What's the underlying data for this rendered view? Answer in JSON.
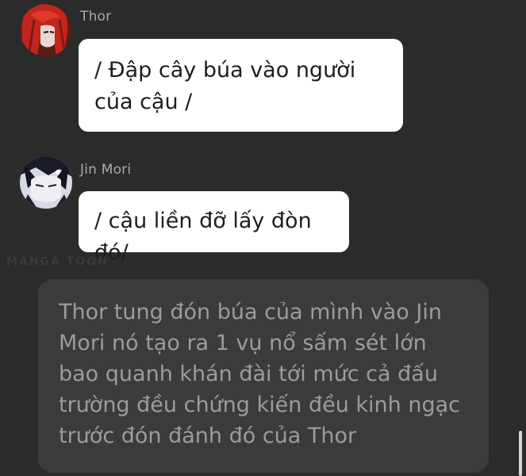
{
  "messages": [
    {
      "sender": "Thor",
      "avatar_icon": "red-haired-character-avatar",
      "text": "/ Đập cây búa vào người của cậu /"
    },
    {
      "sender": "Jin Mori",
      "avatar_icon": "dark-haired-character-avatar",
      "text": "/ cậu liền đỡ lấy đòn đó/"
    }
  ],
  "narration": {
    "text": "Thor tung đón búa của mình vào Jin Mori nó tạo ra 1 vụ nổ sấm sét lớn bao quanh khán đài tới mức cả đấu trường đều chứng kiến đều kinh ngạc trước đón đánh đó của Thor"
  },
  "watermark": "MANGA TOON",
  "colors": {
    "background": "#2b2b2b",
    "bubble": "#ffffff",
    "narration_bg": "#3b3b3b",
    "narration_text": "#9c9c9c",
    "sender_text": "#a9a9a9"
  }
}
